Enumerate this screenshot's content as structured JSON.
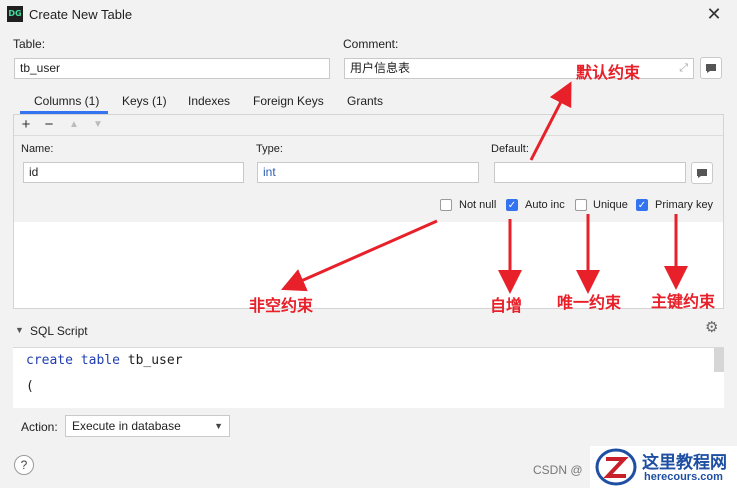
{
  "window": {
    "title": "Create New Table",
    "app_icon": "DG"
  },
  "form": {
    "table_label": "Table:",
    "table_value": "tb_user",
    "comment_label": "Comment:",
    "comment_value": "用户信息表"
  },
  "tabs": [
    {
      "label": "Columns (1)",
      "active": true
    },
    {
      "label": "Keys (1)"
    },
    {
      "label": "Indexes"
    },
    {
      "label": "Foreign Keys"
    },
    {
      "label": "Grants"
    }
  ],
  "toolbar": {
    "add": "+",
    "remove": "−"
  },
  "column": {
    "name_label": "Name:",
    "name_value": "id",
    "type_label": "Type:",
    "type_value": "int",
    "default_label": "Default:",
    "default_value": ""
  },
  "options": [
    {
      "label": "Not null",
      "checked": false
    },
    {
      "label": "Auto inc",
      "checked": true
    },
    {
      "label": "Unique",
      "checked": false
    },
    {
      "label": "Primary key",
      "checked": true
    }
  ],
  "annotations": {
    "default": "默认约束",
    "not_null": "非空约束",
    "auto_inc": "自增",
    "unique": "唯一约束",
    "primary": "主键约束"
  },
  "sql": {
    "header": "SQL Script",
    "line1_kw": "create table",
    "line1_name": "tb_user",
    "line2": "("
  },
  "action": {
    "label": "Action:",
    "value": "Execute in database"
  },
  "help": "?",
  "watermark": {
    "csdn": "CSDN @",
    "site_cn": "这里教程网",
    "site_en": "herecours.com"
  },
  "colors": {
    "accent": "#3574f0",
    "annotation": "#e8202a"
  }
}
